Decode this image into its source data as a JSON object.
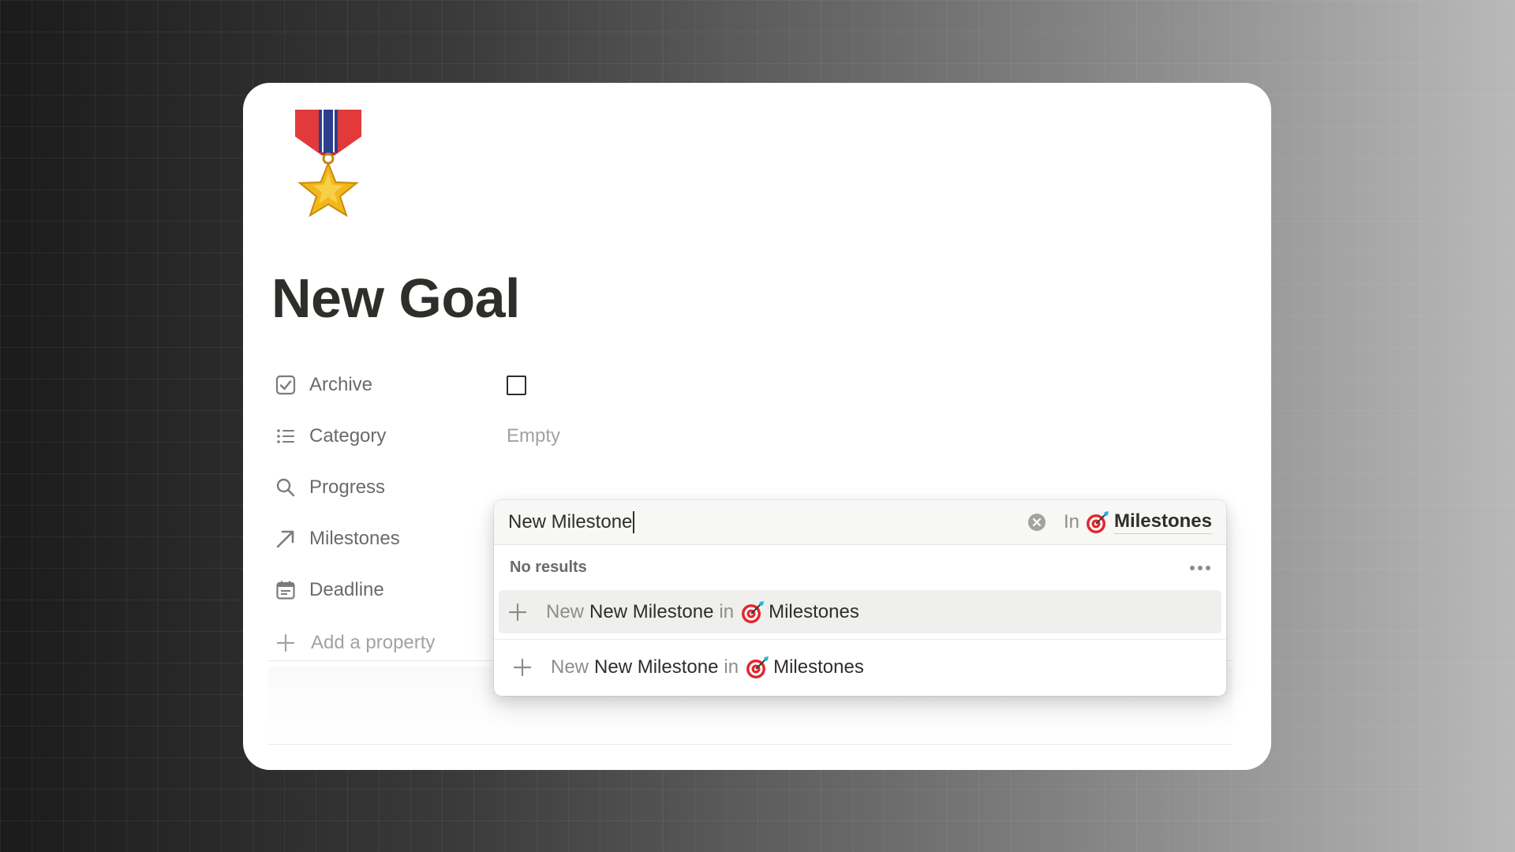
{
  "page": {
    "title": "New Goal",
    "icon": "military-medal-icon"
  },
  "properties": [
    {
      "label": "Archive",
      "icon": "checkbox-icon",
      "value_type": "checkbox",
      "checked": false
    },
    {
      "label": "Category",
      "icon": "list-icon",
      "value": "Empty"
    },
    {
      "label": "Progress",
      "icon": "search-icon"
    },
    {
      "label": "Milestones",
      "icon": "relation-arrow-icon"
    },
    {
      "label": "Deadline",
      "icon": "calendar-icon"
    }
  ],
  "add_property_label": "Add a property",
  "relation_popup": {
    "search_value": "New Milestone",
    "in_label": "In",
    "target_db": "Milestones",
    "target_db_icon": "dart-target-icon",
    "results_header": "No results",
    "options": [
      {
        "prefix": "New",
        "name": "New Milestone",
        "in": "in",
        "db": "Milestones",
        "highlighted": true
      },
      {
        "prefix": "New",
        "name": "New Milestone",
        "in": "in",
        "db": "Milestones",
        "highlighted": false
      }
    ]
  },
  "colors": {
    "title_text": "#2f2e2a",
    "muted_text": "#6b6a66",
    "placeholder_text": "#a3a29e",
    "highlight_row": "#efefed"
  }
}
